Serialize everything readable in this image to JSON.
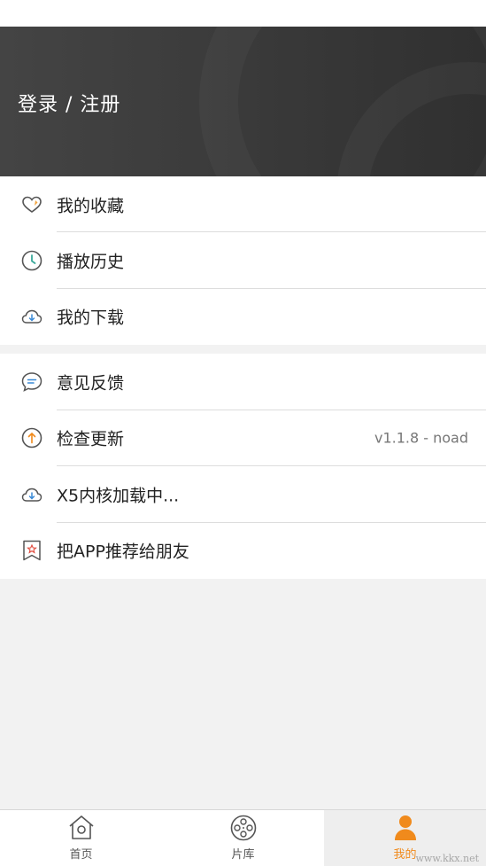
{
  "header": {
    "login_label": "登录 / 注册"
  },
  "group1": [
    {
      "label": "我的收藏",
      "icon": "heart-icon"
    },
    {
      "label": "播放历史",
      "icon": "clock-icon"
    },
    {
      "label": "我的下载",
      "icon": "cloud-download-icon"
    }
  ],
  "group2": [
    {
      "label": "意见反馈",
      "icon": "chat-bubble-icon"
    },
    {
      "label": "检查更新",
      "icon": "arrow-up-circle-icon",
      "value": "v1.1.8 - noad"
    },
    {
      "label": "X5内核加载中...",
      "icon": "cloud-download-icon"
    },
    {
      "label": "把APP推荐给朋友",
      "icon": "bookmark-star-icon"
    }
  ],
  "bottom_nav": [
    {
      "label": "首页",
      "icon": "home-icon"
    },
    {
      "label": "片库",
      "icon": "film-reel-icon"
    },
    {
      "label": "我的",
      "icon": "user-icon",
      "active": true
    }
  ],
  "watermark": "www.kkx.net",
  "colors": {
    "accent": "#f08a1c",
    "header_bg": "#3a3a3a",
    "divider": "#dddddd"
  }
}
